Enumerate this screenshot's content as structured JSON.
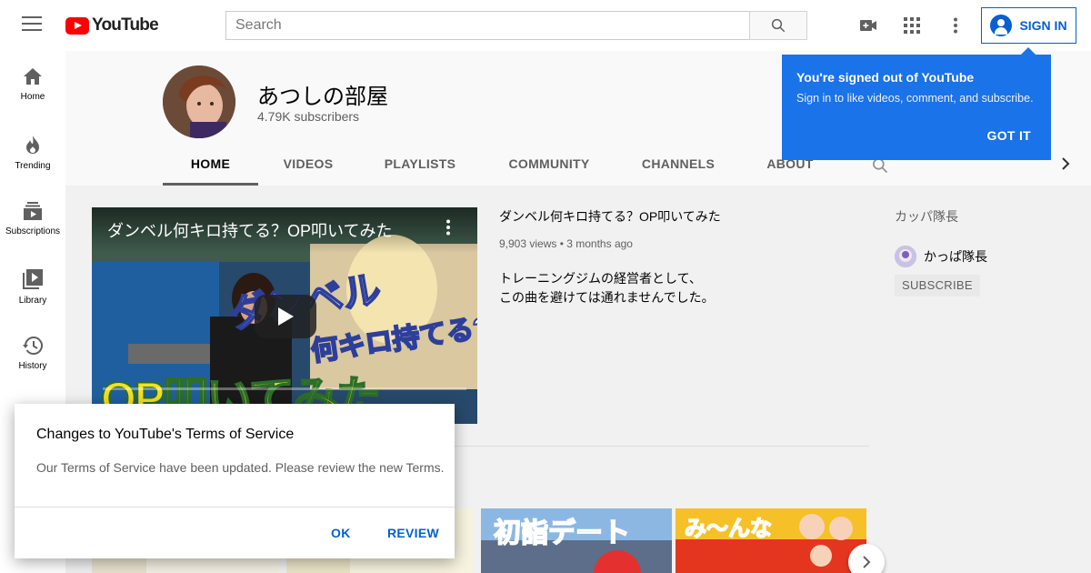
{
  "header": {
    "logo_text": "YouTube",
    "search_placeholder": "Search",
    "sign_in_label": "SIGN IN"
  },
  "sidebar": {
    "items": [
      {
        "label": "Home",
        "icon": "home-icon"
      },
      {
        "label": "Trending",
        "icon": "flame-icon"
      },
      {
        "label": "Subscriptions",
        "icon": "subscriptions-icon"
      },
      {
        "label": "Library",
        "icon": "library-icon"
      },
      {
        "label": "History",
        "icon": "history-icon"
      }
    ]
  },
  "channel": {
    "name": "あつしの部屋",
    "subscribers": "4.79K subscribers",
    "tabs": [
      {
        "label": "HOME",
        "active": true
      },
      {
        "label": "VIDEOS"
      },
      {
        "label": "PLAYLISTS"
      },
      {
        "label": "COMMUNITY"
      },
      {
        "label": "CHANNELS"
      },
      {
        "label": "ABOUT"
      }
    ]
  },
  "featured_video": {
    "overlay_title": "ダンベル何キロ持てる？OP叩いてみた",
    "title": "ダンベル何キロ持てる？OP叩いてみた",
    "views": "9,903 views",
    "age": "3 months ago",
    "description_line1": "トレーニングジムの経営者として、",
    "description_line2": "この曲を避けては通れませんでした。",
    "thumb_text_top": "ダンベル",
    "thumb_text_mid": "何キロ持てる?",
    "thumb_text_bottom": "OP叩いてみた"
  },
  "featured_channels": {
    "title": "カッパ隊長",
    "channel_name": "かっぱ隊長",
    "subscribe_label": "SUBSCRIBE"
  },
  "thumbnails": {
    "third_text": "初詣デート",
    "fourth_text": "み〜んな"
  },
  "signed_out_tooltip": {
    "title": "You're signed out of YouTube",
    "body": "Sign in to like videos, comment, and subscribe.",
    "button": "GOT IT"
  },
  "terms_dialog": {
    "title": "Changes to YouTube's Terms of Service",
    "body": "Our Terms of Service have been updated. Please review the new Terms.",
    "ok_label": "OK",
    "review_label": "REVIEW"
  },
  "colors": {
    "brand_red": "#ff0000",
    "accent_blue": "#065fd4",
    "tooltip_blue": "#1a73e8"
  }
}
